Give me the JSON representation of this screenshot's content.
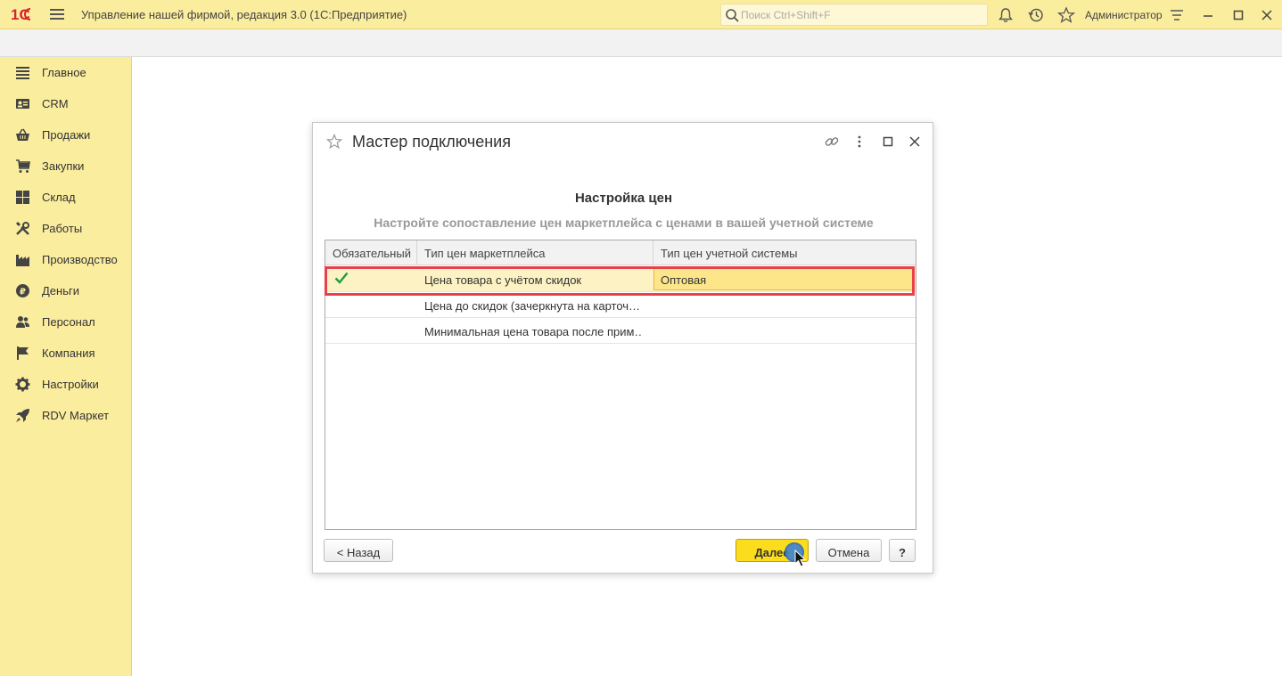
{
  "titlebar": {
    "app_title": "Управление нашей фирмой, редакция 3.0  (1С:Предприятие)",
    "search_placeholder": "Поиск Ctrl+Shift+F",
    "user": "Администратор",
    "icons": [
      "bell-icon",
      "history-icon",
      "star-icon",
      "settings-lines-icon"
    ]
  },
  "sidebar": {
    "items": [
      {
        "label": "Главное",
        "icon": "menu-lines-icon"
      },
      {
        "label": "CRM",
        "icon": "contact-card-icon"
      },
      {
        "label": "Продажи",
        "icon": "basket-icon"
      },
      {
        "label": "Закупки",
        "icon": "cart-icon"
      },
      {
        "label": "Склад",
        "icon": "warehouse-grid-icon"
      },
      {
        "label": "Работы",
        "icon": "tools-icon"
      },
      {
        "label": "Производство",
        "icon": "factory-icon"
      },
      {
        "label": "Деньги",
        "icon": "ruble-coin-icon"
      },
      {
        "label": "Персонал",
        "icon": "people-icon"
      },
      {
        "label": "Компания",
        "icon": "flag-icon"
      },
      {
        "label": "Настройки",
        "icon": "gear-icon"
      },
      {
        "label": "RDV Маркет",
        "icon": "rocket-icon"
      }
    ]
  },
  "dialog": {
    "title": "Мастер подключения",
    "section_title": "Настройка цен",
    "section_subtitle": "Настройте сопоставление цен маркетплейса с ценами в вашей учетной системе",
    "columns": [
      "Обязательный",
      "Тип цен маркетплейса",
      "Тип цен учетной системы"
    ],
    "rows": [
      {
        "required": true,
        "marketplace_price": "Цена товара с учётом скидок",
        "system_price": "Оптовая",
        "selected": true
      },
      {
        "required": false,
        "marketplace_price": "Цена до скидок (зачеркнута на карточ…",
        "system_price": "",
        "selected": false
      },
      {
        "required": false,
        "marketplace_price": "Минимальная цена товара после прим…",
        "system_price": "",
        "selected": false
      }
    ],
    "buttons": {
      "back": "< Назад",
      "next": "Далее",
      "cancel": "Отмена",
      "help": "?"
    }
  },
  "colors": {
    "accent_yellow": "#fbed9e",
    "primary_button": "#fcdd1d",
    "highlight_red": "#e8414b",
    "check_green": "#1f9d3a"
  }
}
